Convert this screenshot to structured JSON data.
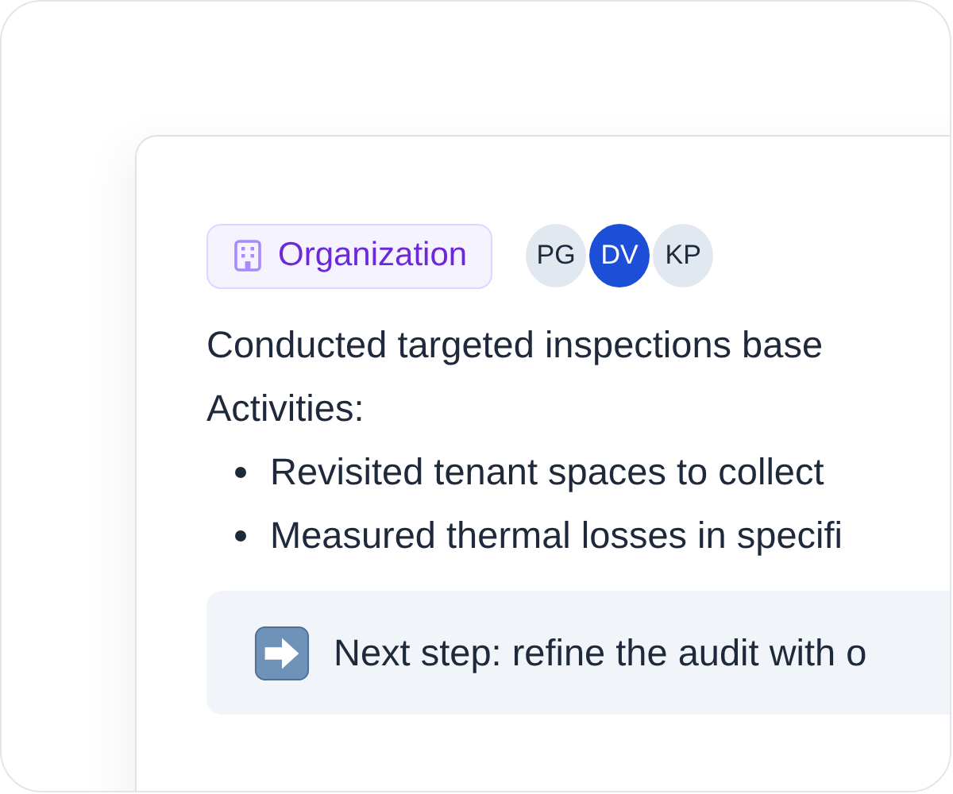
{
  "tag": {
    "label": "Organization"
  },
  "avatars": [
    {
      "initials": "PG",
      "color": "#e2e8f0"
    },
    {
      "initials": "DV",
      "color": "#1d4ed8"
    },
    {
      "initials": "KP",
      "color": "#e2e8f0"
    }
  ],
  "summary": "Conducted targeted inspections base",
  "activities_label": "Activities:",
  "activities": [
    "Revisited tenant spaces to collect",
    "Measured thermal losses in specifi"
  ],
  "callout": {
    "text": "Next step: refine the audit with o"
  }
}
